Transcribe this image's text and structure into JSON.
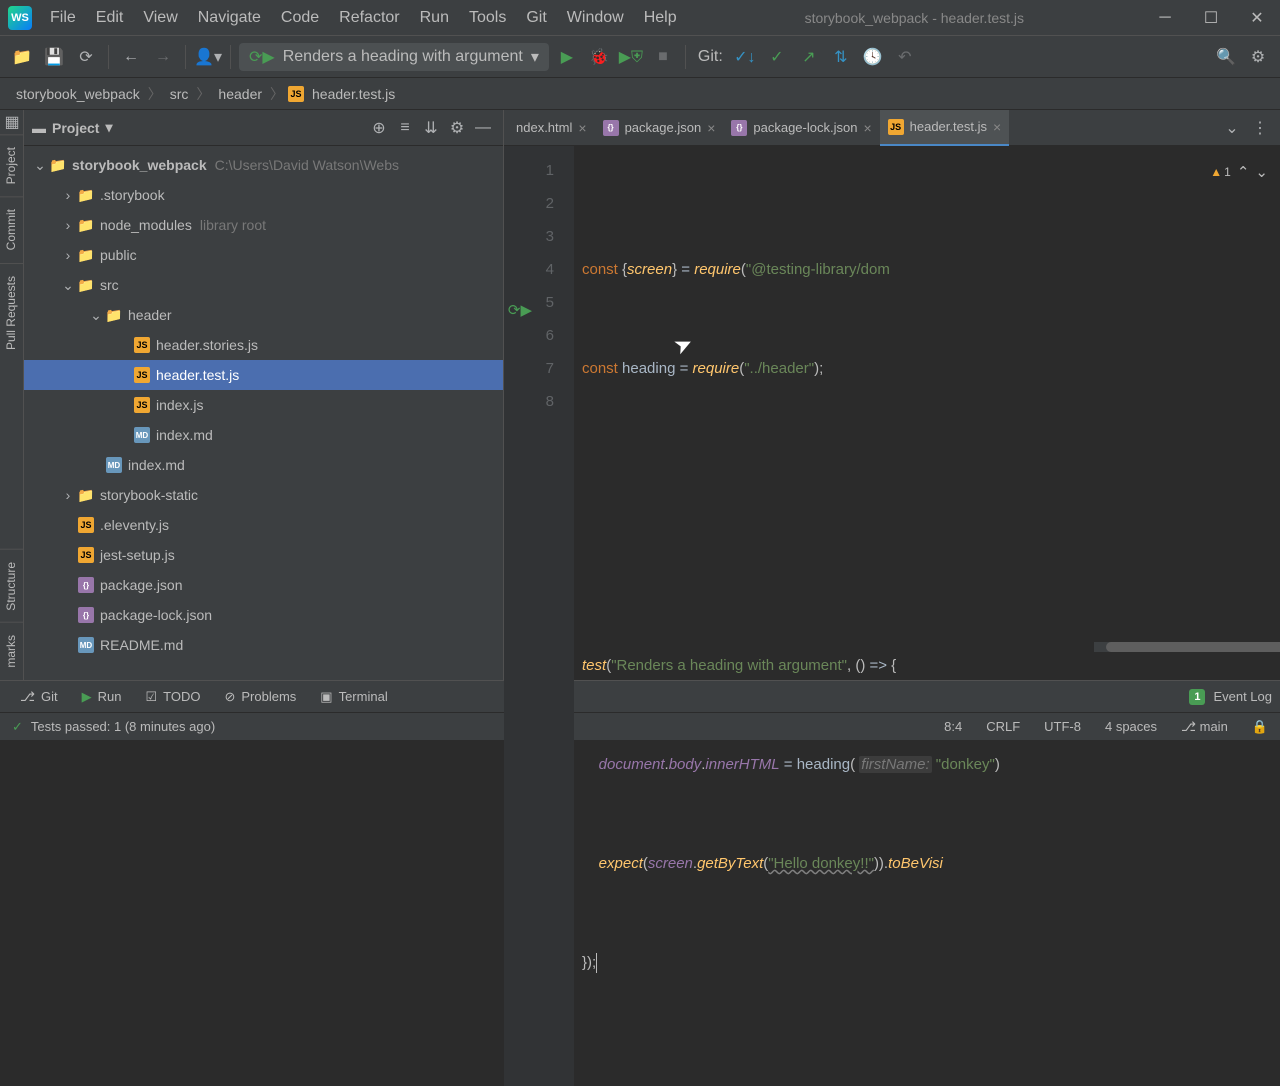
{
  "window_title": "storybook_webpack - header.test.js",
  "menu": [
    "File",
    "Edit",
    "View",
    "Navigate",
    "Code",
    "Refactor",
    "Run",
    "Tools",
    "Git",
    "Window",
    "Help"
  ],
  "run_config": "Renders a heading with argument",
  "git_label": "Git:",
  "breadcrumbs": [
    "storybook_webpack",
    "src",
    "header",
    "header.test.js"
  ],
  "sidebar": {
    "title": "Project",
    "root": "storybook_webpack",
    "root_path": "C:\\Users\\David Watson\\Webs",
    "items": [
      {
        "name": ".storybook",
        "type": "folder",
        "indent": 1,
        "arrow": "›"
      },
      {
        "name": "node_modules",
        "type": "folder",
        "indent": 1,
        "arrow": "›",
        "suffix": "library root"
      },
      {
        "name": "public",
        "type": "folder",
        "indent": 1,
        "arrow": "›"
      },
      {
        "name": "src",
        "type": "folder",
        "indent": 1,
        "arrow": "⌄"
      },
      {
        "name": "header",
        "type": "folder",
        "indent": 2,
        "arrow": "⌄"
      },
      {
        "name": "header.stories.js",
        "type": "js",
        "indent": 3
      },
      {
        "name": "header.test.js",
        "type": "js",
        "indent": 3,
        "selected": true
      },
      {
        "name": "index.js",
        "type": "js",
        "indent": 3
      },
      {
        "name": "index.md",
        "type": "md",
        "indent": 3
      },
      {
        "name": "index.md",
        "type": "md",
        "indent": 2
      },
      {
        "name": "storybook-static",
        "type": "folder",
        "indent": 1,
        "arrow": "›"
      },
      {
        "name": ".eleventy.js",
        "type": "js",
        "indent": 1
      },
      {
        "name": "jest-setup.js",
        "type": "js",
        "indent": 1
      },
      {
        "name": "package.json",
        "type": "json",
        "indent": 1
      },
      {
        "name": "package-lock.json",
        "type": "json",
        "indent": 1
      },
      {
        "name": "README.md",
        "type": "md",
        "indent": 1
      }
    ]
  },
  "tabs": [
    {
      "name": "ndex.html",
      "icon": "html"
    },
    {
      "name": "package.json",
      "icon": "json"
    },
    {
      "name": "package-lock.json",
      "icon": "json"
    },
    {
      "name": "header.test.js",
      "icon": "js",
      "active": true
    }
  ],
  "line_count": 8,
  "warnings": {
    "yellow": 1,
    "count": 1
  },
  "code": {
    "l1_kw": "const",
    "l1_screen": "screen",
    "l1_req": "require",
    "l1_path": "\"@testing-library/dom",
    "l2_kw": "const",
    "l2_var": "heading",
    "l2_req": "require",
    "l2_path": "\"../header\"",
    "l5_fn": "test",
    "l5_str": "\"Renders a heading with argument\"",
    "l6_doc": "document",
    "l6_body": "body",
    "l6_inner": "innerHTML",
    "l6_heading": "heading",
    "l6_hint": "firstName:",
    "l6_val": "\"donkey\"",
    "l7_expect": "expect",
    "l7_screen": "screen",
    "l7_get": "getByText",
    "l7_str": "\"Hello donkey!!\"",
    "l7_tobe": "toBeVisi"
  },
  "gutter": [
    "Project",
    "Commit",
    "Pull Requests",
    "Structure",
    "marks"
  ],
  "bottom_tabs": [
    "Git",
    "Run",
    "TODO",
    "Problems",
    "Terminal"
  ],
  "event_log": "Event Log",
  "event_count": "1",
  "status": {
    "msg": "Tests passed: 1 (8 minutes ago)",
    "pos": "8:4",
    "lineend": "CRLF",
    "encoding": "UTF-8",
    "indent": "4 spaces",
    "branch": "main"
  }
}
